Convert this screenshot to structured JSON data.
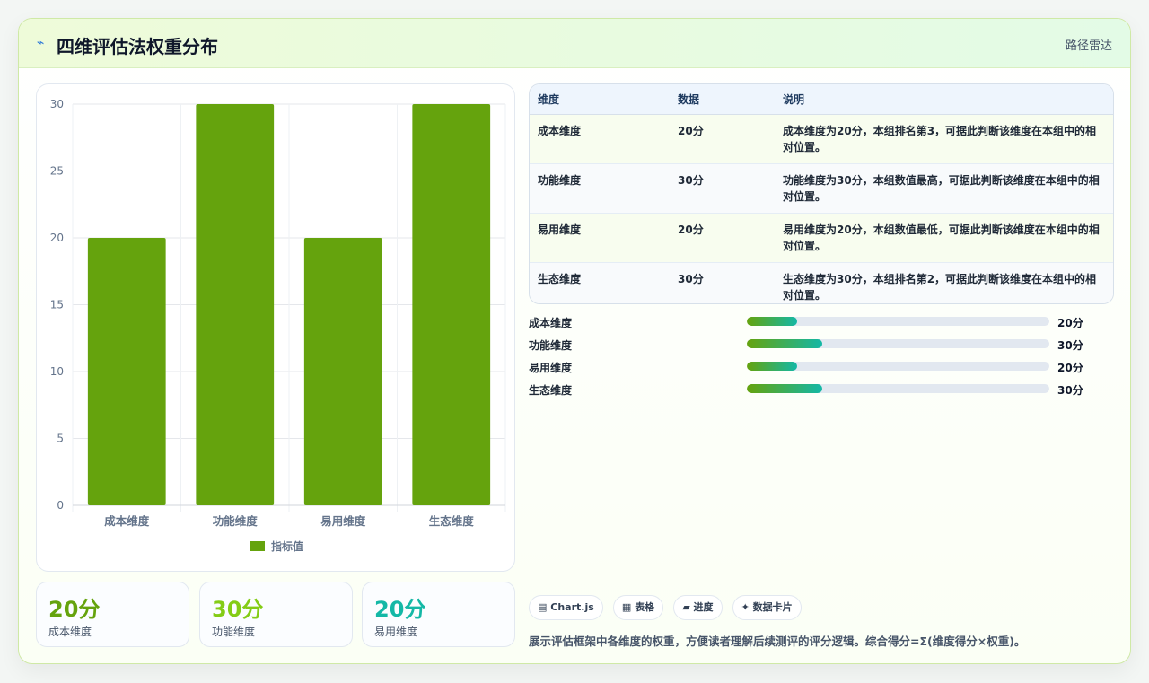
{
  "header": {
    "icon": "line-chart-icon",
    "title": "四维评估法权重分布",
    "right_label": "路径雷达"
  },
  "colors": {
    "bar": "#65a30d",
    "accent_teal": "#14b8a6",
    "accent_lime": "#84cc16"
  },
  "chart_data": {
    "type": "bar",
    "categories": [
      "成本维度",
      "功能维度",
      "易用维度",
      "生态维度"
    ],
    "series": [
      {
        "name": "指标值",
        "values": [
          20,
          30,
          20,
          30
        ]
      }
    ],
    "ylim": [
      0,
      30
    ],
    "yticks": [
      0,
      5,
      10,
      15,
      20,
      25,
      30
    ],
    "legend": "bottom",
    "grid": true
  },
  "stats": [
    {
      "value": "20分",
      "label": "成本维度",
      "color": "#65a30d"
    },
    {
      "value": "30分",
      "label": "功能维度",
      "color": "#84cc16"
    },
    {
      "value": "20分",
      "label": "易用维度",
      "color": "#14b8a6"
    }
  ],
  "table": {
    "headers": [
      "维度",
      "数据",
      "说明"
    ],
    "rows": [
      [
        "成本维度",
        "20分",
        "成本维度为20分，本组排名第3，可据此判断该维度在本组中的相对位置。"
      ],
      [
        "功能维度",
        "30分",
        "功能维度为30分，本组数值最高，可据此判断该维度在本组中的相对位置。"
      ],
      [
        "易用维度",
        "20分",
        "易用维度为20分，本组数值最低，可据此判断该维度在本组中的相对位置。"
      ],
      [
        "生态维度",
        "30分",
        "生态维度为30分，本组排名第2，可据此判断该维度在本组中的相对位置。"
      ]
    ]
  },
  "progress": [
    {
      "label": "成本维度",
      "value_text": "20分",
      "percent": 16.5
    },
    {
      "label": "功能维度",
      "value_text": "30分",
      "percent": 25
    },
    {
      "label": "易用维度",
      "value_text": "20分",
      "percent": 16.5
    },
    {
      "label": "生态维度",
      "value_text": "30分",
      "percent": 25
    }
  ],
  "tags": [
    {
      "icon": "▤",
      "label": "Chart.js"
    },
    {
      "icon": "▦",
      "label": "表格"
    },
    {
      "icon": "▰",
      "label": "进度"
    },
    {
      "icon": "✦",
      "label": "数据卡片"
    }
  ],
  "footnote": "展示评估框架中各维度的权重，方便读者理解后续测评的评分逻辑。综合得分=Σ(维度得分×权重)。"
}
